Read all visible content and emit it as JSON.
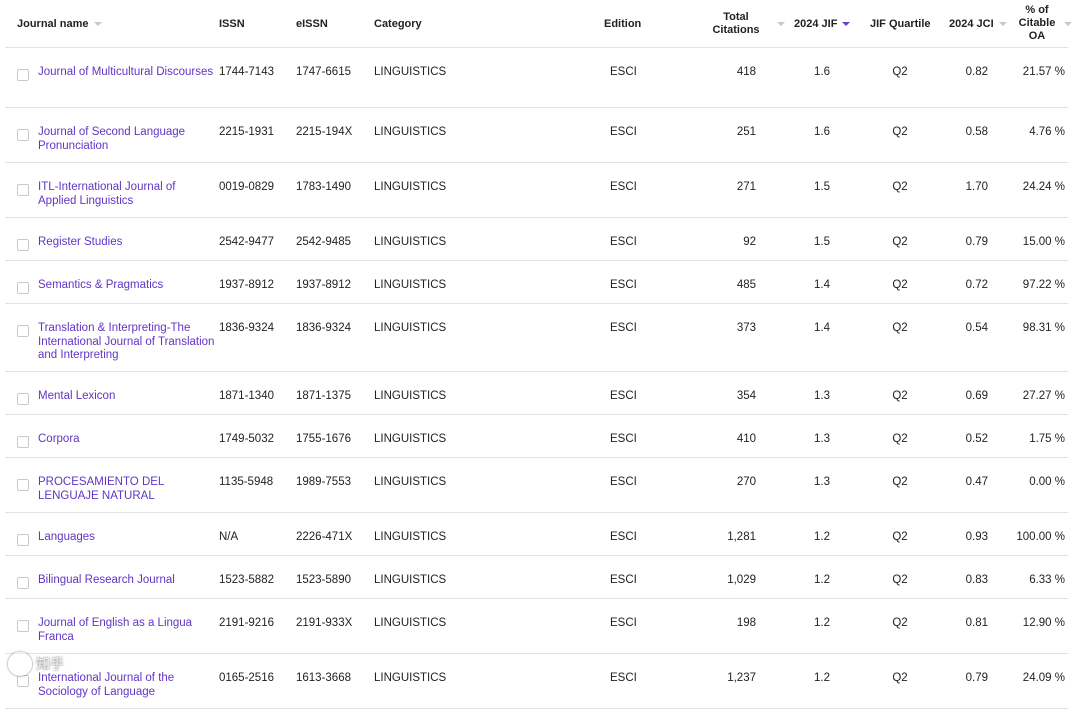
{
  "columns": {
    "journal_name": "Journal name",
    "issn": "ISSN",
    "eissn": "eISSN",
    "category": "Category",
    "edition": "Edition",
    "total_citations": "Total Citations",
    "jif": "2024 JIF",
    "jif_quartile": "JIF Quartile",
    "jci": "2024 JCI",
    "citable_oa": "% of Citable OA"
  },
  "colors": {
    "link": "#6236c5",
    "sort_active": "#6d3ec7",
    "border": "#e2e2e2"
  },
  "rows": [
    {
      "name": "Journal of Multicultural Discourses",
      "issn": "1744-7143",
      "eissn": "1747-6615",
      "category": "LINGUISTICS",
      "edition": "ESCI",
      "citations": "418",
      "jif": "1.6",
      "quartile": "Q2",
      "jci": "0.82",
      "oa": "21.57 %"
    },
    {
      "name": "Journal of Second Language Pronunciation",
      "issn": "2215-1931",
      "eissn": "2215-194X",
      "category": "LINGUISTICS",
      "edition": "ESCI",
      "citations": "251",
      "jif": "1.6",
      "quartile": "Q2",
      "jci": "0.58",
      "oa": "4.76 %"
    },
    {
      "name": "ITL-International Journal of Applied Linguistics",
      "issn": "0019-0829",
      "eissn": "1783-1490",
      "category": "LINGUISTICS",
      "edition": "ESCI",
      "citations": "271",
      "jif": "1.5",
      "quartile": "Q2",
      "jci": "1.70",
      "oa": "24.24 %"
    },
    {
      "name": "Register Studies",
      "issn": "2542-9477",
      "eissn": "2542-9485",
      "category": "LINGUISTICS",
      "edition": "ESCI",
      "citations": "92",
      "jif": "1.5",
      "quartile": "Q2",
      "jci": "0.79",
      "oa": "15.00 %"
    },
    {
      "name": "Semantics & Pragmatics",
      "issn": "1937-8912",
      "eissn": "1937-8912",
      "category": "LINGUISTICS",
      "edition": "ESCI",
      "citations": "485",
      "jif": "1.4",
      "quartile": "Q2",
      "jci": "0.72",
      "oa": "97.22 %"
    },
    {
      "name": "Translation & Interpreting-The International Journal of Translation and Interpreting",
      "issn": "1836-9324",
      "eissn": "1836-9324",
      "category": "LINGUISTICS",
      "edition": "ESCI",
      "citations": "373",
      "jif": "1.4",
      "quartile": "Q2",
      "jci": "0.54",
      "oa": "98.31 %"
    },
    {
      "name": "Mental Lexicon",
      "issn": "1871-1340",
      "eissn": "1871-1375",
      "category": "LINGUISTICS",
      "edition": "ESCI",
      "citations": "354",
      "jif": "1.3",
      "quartile": "Q2",
      "jci": "0.69",
      "oa": "27.27 %"
    },
    {
      "name": "Corpora",
      "issn": "1749-5032",
      "eissn": "1755-1676",
      "category": "LINGUISTICS",
      "edition": "ESCI",
      "citations": "410",
      "jif": "1.3",
      "quartile": "Q2",
      "jci": "0.52",
      "oa": "1.75 %"
    },
    {
      "name": "PROCESAMIENTO DEL LENGUAJE NATURAL",
      "issn": "1135-5948",
      "eissn": "1989-7553",
      "category": "LINGUISTICS",
      "edition": "ESCI",
      "citations": "270",
      "jif": "1.3",
      "quartile": "Q2",
      "jci": "0.47",
      "oa": "0.00 %"
    },
    {
      "name": "Languages",
      "issn": "N/A",
      "eissn": "2226-471X",
      "category": "LINGUISTICS",
      "edition": "ESCI",
      "citations": "1,281",
      "jif": "1.2",
      "quartile": "Q2",
      "jci": "0.93",
      "oa": "100.00 %"
    },
    {
      "name": "Bilingual Research Journal",
      "issn": "1523-5882",
      "eissn": "1523-5890",
      "category": "LINGUISTICS",
      "edition": "ESCI",
      "citations": "1,029",
      "jif": "1.2",
      "quartile": "Q2",
      "jci": "0.83",
      "oa": "6.33 %"
    },
    {
      "name": "Journal of English as a Lingua Franca",
      "issn": "2191-9216",
      "eissn": "2191-933X",
      "category": "LINGUISTICS",
      "edition": "ESCI",
      "citations": "198",
      "jif": "1.2",
      "quartile": "Q2",
      "jci": "0.81",
      "oa": "12.90 %"
    },
    {
      "name": "International Journal of the Sociology of Language",
      "issn": "0165-2516",
      "eissn": "1613-3668",
      "category": "LINGUISTICS",
      "edition": "ESCI",
      "citations": "1,237",
      "jif": "1.2",
      "quartile": "Q2",
      "jci": "0.79",
      "oa": "24.09 %"
    }
  ],
  "watermark": "知乎"
}
